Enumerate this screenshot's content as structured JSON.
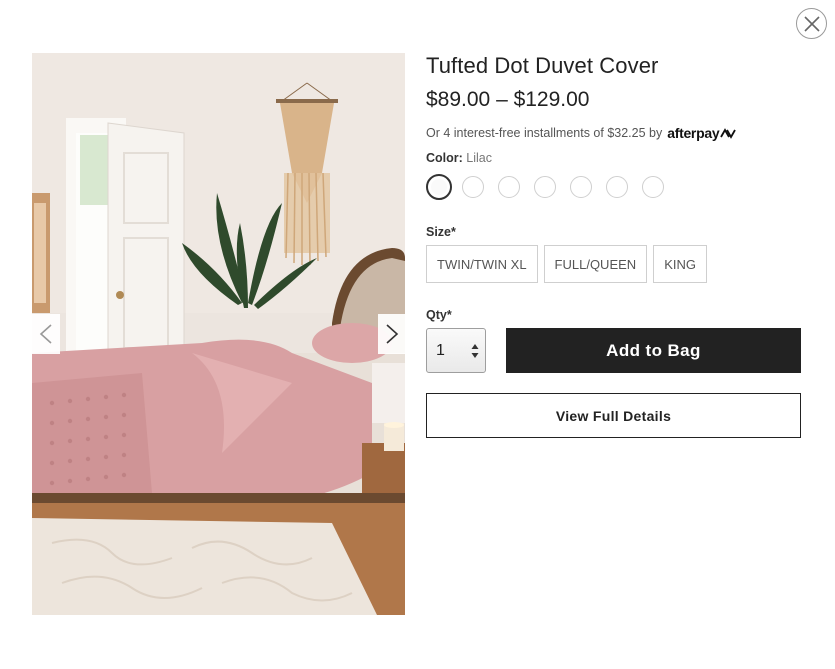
{
  "modal": {
    "close_icon": "close-circle-icon"
  },
  "gallery": {
    "image_alt": "Pink tufted dot duvet cover on bed in bright bedroom",
    "prev_icon": "chevron-left-icon",
    "next_icon": "chevron-right-icon"
  },
  "product": {
    "title": "Tufted Dot Duvet Cover",
    "price_range": "$89.00 – $129.00",
    "afterpay_text": "Or 4 interest-free installments of $32.25 by",
    "afterpay_brand": "afterpay",
    "color_label": "Color:",
    "color_value": "Lilac",
    "swatch_count": 7,
    "selected_swatch": 0,
    "size_label": "Size*",
    "sizes": [
      "TWIN/TWIN XL",
      "FULL/QUEEN",
      "KING"
    ],
    "qty_label": "Qty*",
    "qty_value": "1",
    "add_to_bag_label": "Add to Bag",
    "view_details_label": "View Full Details"
  },
  "colors": {
    "button_dark": "#222222",
    "duvet_pink": "#d9a3a4",
    "wall": "#ece4de"
  }
}
